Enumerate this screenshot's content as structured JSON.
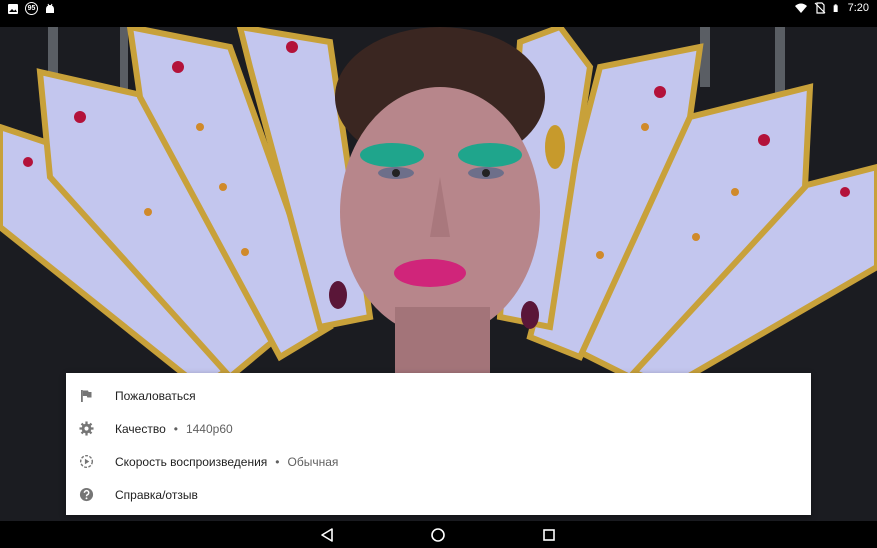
{
  "status_bar": {
    "left_icons": [
      "image-icon",
      "notification-count-icon",
      "android-icon"
    ],
    "notification_count": "95",
    "right_icons": [
      "wifi-icon",
      "no-sim-icon",
      "battery-icon"
    ],
    "time": "7:20"
  },
  "video": {
    "description_icon": "video-frame"
  },
  "menu": {
    "items": [
      {
        "icon": "flag-icon",
        "label": "Пожаловаться",
        "value": ""
      },
      {
        "icon": "gear-icon",
        "label": "Качество",
        "separator": "•",
        "value": "1440p60"
      },
      {
        "icon": "playback-speed-icon",
        "label": "Скорость воспроизведения",
        "separator": "•",
        "value": "Обычная"
      },
      {
        "icon": "help-icon",
        "label": "Справка/отзыв",
        "value": ""
      }
    ]
  },
  "nav_bar": {
    "buttons": [
      "back-icon",
      "home-icon",
      "recents-icon"
    ]
  },
  "colors": {
    "menu_background": "#ffffff",
    "menu_text": "#212121",
    "menu_secondary_text": "#606060",
    "icon_gray": "#757575",
    "bars": "#000000"
  }
}
